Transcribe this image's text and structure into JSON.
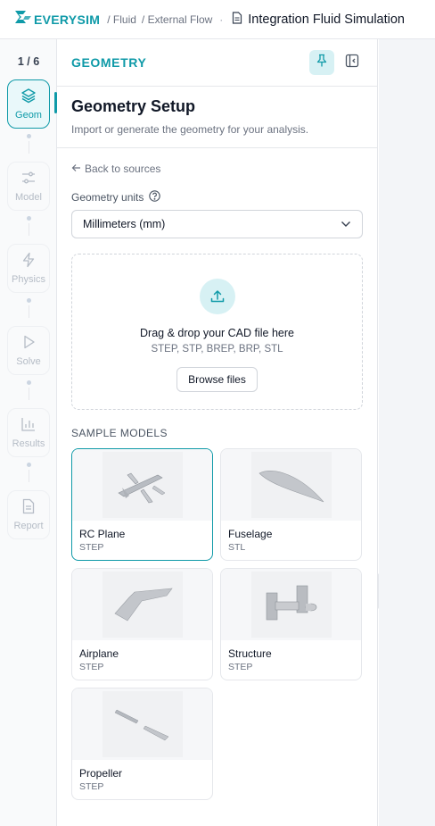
{
  "header": {
    "logo_text": "EVERYSIM",
    "breadcrumb": [
      "/ Fluid",
      "/ External Flow"
    ],
    "separator": "·",
    "document_title": "Integration Fluid Simulation"
  },
  "stepper": {
    "count": "1 / 6",
    "steps": [
      {
        "label": "Geom",
        "icon": "layers-icon",
        "active": true
      },
      {
        "label": "Model",
        "icon": "sliders-icon",
        "active": false
      },
      {
        "label": "Physics",
        "icon": "lightning-icon",
        "active": false
      },
      {
        "label": "Solve",
        "icon": "play-icon",
        "active": false
      },
      {
        "label": "Results",
        "icon": "bar-chart-icon",
        "active": false
      },
      {
        "label": "Report",
        "icon": "document-icon",
        "active": false
      }
    ]
  },
  "panel": {
    "title": "GEOMETRY",
    "heading": "Geometry Setup",
    "subtitle": "Import or generate the geometry for your analysis.",
    "back_label": "Back to sources",
    "units_label": "Geometry units",
    "units_value": "Millimeters (mm)",
    "dropzone": {
      "title": "Drag & drop your CAD file here",
      "formats": "STEP, STP, BREP, BRP, STL",
      "button": "Browse files"
    },
    "samples_label": "SAMPLE MODELS",
    "samples": [
      {
        "name": "RC Plane",
        "format": "STEP",
        "selected": true
      },
      {
        "name": "Fuselage",
        "format": "STL",
        "selected": false
      },
      {
        "name": "Airplane",
        "format": "STEP",
        "selected": false
      },
      {
        "name": "Structure",
        "format": "STEP",
        "selected": false
      },
      {
        "name": "Propeller",
        "format": "STEP",
        "selected": false
      }
    ]
  },
  "colors": {
    "accent": "#0f9aa8",
    "accent_light": "#d7f1f4",
    "border": "#e5e7eb"
  }
}
